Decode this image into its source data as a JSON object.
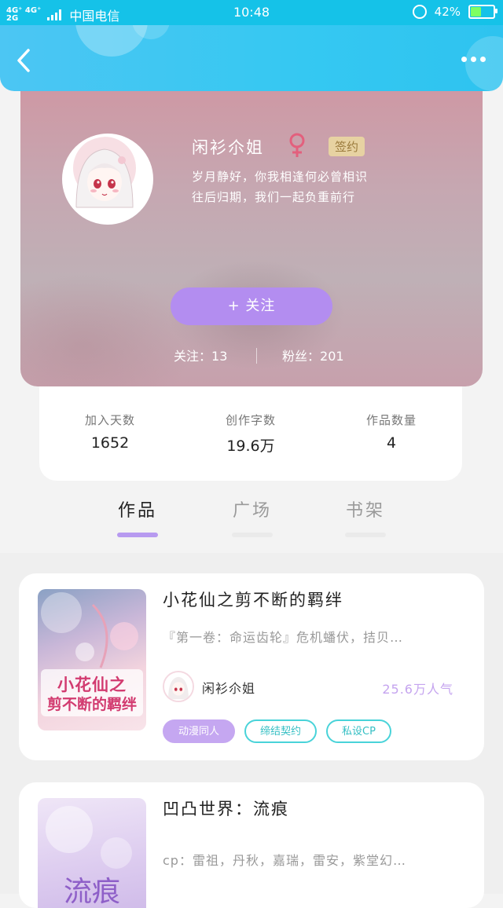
{
  "status_bar": {
    "network_top": "4G⁺ 4G⁺",
    "network_bottom": "2G",
    "carrier": "中国电信",
    "time": "10:48",
    "battery": "42%",
    "battery_level": 0.42
  },
  "header": {
    "back_icon": "chevron-left-icon",
    "more_icon": "more-dots-icon"
  },
  "profile": {
    "username": "闲衫尒姐",
    "gender_symbol": "♀",
    "badge": "签约",
    "bio_line1": "岁月静好，你我相逢何必曾相识",
    "bio_line2": "往后归期，我们一起负重前行",
    "follow_button": "+  关注",
    "following_label": "关注：",
    "following_count": "13",
    "fans_label": "粉丝：",
    "fans_count": "201"
  },
  "stats": [
    {
      "label": "加入天数",
      "value": "1652"
    },
    {
      "label": "创作字数",
      "value": "19.6万"
    },
    {
      "label": "作品数量",
      "value": "4"
    }
  ],
  "tabs": [
    {
      "label": "作品",
      "active": true
    },
    {
      "label": "广场",
      "active": false
    },
    {
      "label": "书架",
      "active": false
    }
  ],
  "books": [
    {
      "title": "小花仙之剪不断的羁绊",
      "description": "『第一卷：命运齿轮』危机蟠伏，拮贝…",
      "author": "闲衫尒姐",
      "popularity": "25.6万人气",
      "cover_text_line1": "小花仙之",
      "cover_text_line2": "剪不断的羁绊",
      "tags": [
        "动漫同人",
        "缔结契约",
        "私设CP"
      ]
    },
    {
      "title": "凹凸世界：流痕",
      "description": "cp：雷祖，丹秋，嘉瑞，雷安，紫堂幻…",
      "cover_text": "流痕"
    }
  ]
}
